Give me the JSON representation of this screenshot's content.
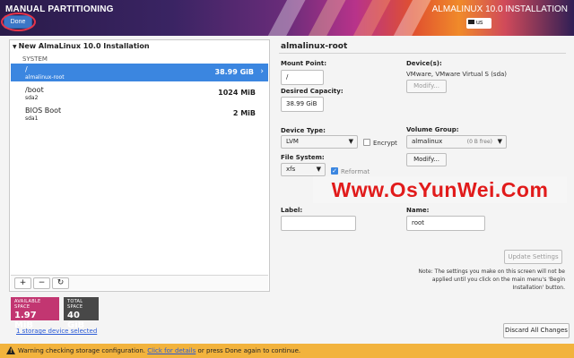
{
  "header": {
    "title": "MANUAL PARTITIONING",
    "done_label": "Done",
    "install_title": "ALMALINUX 10.0 INSTALLATION",
    "keyboard_layout": "us",
    "colors": {
      "accent": "#3b76c6",
      "highlight_ring": "#e8344a"
    }
  },
  "tree": {
    "title": "New AlmaLinux 10.0 Installation",
    "section": "SYSTEM",
    "partitions": [
      {
        "mount": "/",
        "device": "almalinux-root",
        "size": "38.99 GiB",
        "selected": true
      },
      {
        "mount": "/boot",
        "device": "sda2",
        "size": "1024 MiB",
        "selected": false
      },
      {
        "mount": "BIOS Boot",
        "device": "sda1",
        "size": "2 MiB",
        "selected": false
      }
    ],
    "toolbar": {
      "add": "+",
      "remove": "−",
      "refresh": "↻"
    }
  },
  "space": {
    "available_caption": "AVAILABLE SPACE",
    "available_value": "1.97 MiB",
    "total_caption": "TOTAL SPACE",
    "total_value": "40 GiB",
    "available_color": "#c23671",
    "total_color": "#484848"
  },
  "storage_link": "1 storage device selected",
  "detail": {
    "title": "almalinux-root",
    "mount_point_label": "Mount Point:",
    "mount_point_value": "/",
    "capacity_label": "Desired Capacity:",
    "capacity_value": "38.99 GiB",
    "devices_label": "Device(s):",
    "devices_value": "VMware, VMware Virtual S (sda)",
    "modify_label": "Modify...",
    "device_type_label": "Device Type:",
    "device_type_value": "LVM",
    "encrypt_label": "Encrypt",
    "volume_group_label": "Volume Group:",
    "volume_group_value": "almalinux",
    "volume_group_free": "(0 B free)",
    "vg_modify_label": "Modify...",
    "fs_label": "File System:",
    "fs_value": "xfs",
    "reformat_label": "Reformat",
    "label_label": "Label:",
    "label_value": "",
    "name_label": "Name:",
    "name_value": "root",
    "update_label": "Update Settings",
    "note": "Note:  The settings you make on this screen will not be applied until you click on the main menu's 'Begin Installation' button."
  },
  "watermark": "Www.OsYunWei.Com",
  "discard_label": "Discard All Changes",
  "warning": {
    "prefix": "Warning checking storage configuration. ",
    "link": "Click for details",
    "suffix": " or press Done again to continue.",
    "color": "#f2b33d"
  }
}
